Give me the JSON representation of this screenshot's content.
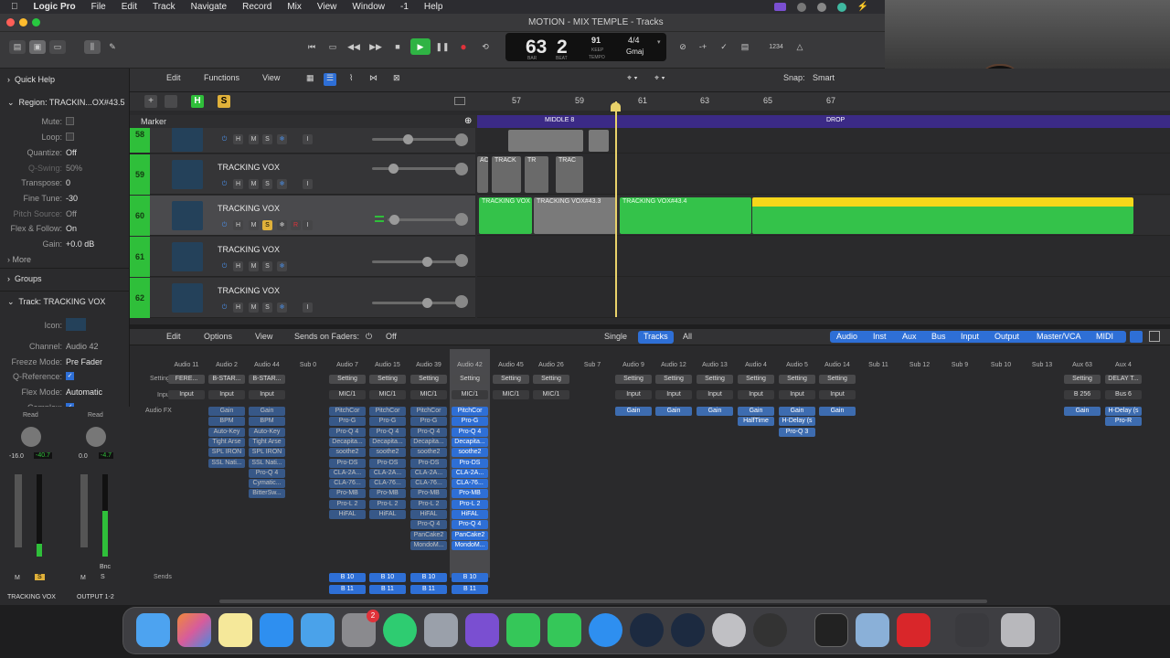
{
  "menubar": {
    "app": "Logic Pro",
    "items": [
      "File",
      "Edit",
      "Track",
      "Navigate",
      "Record",
      "Mix",
      "View",
      "Window",
      "-1",
      "Help"
    ]
  },
  "window": {
    "title": "MOTION - MIX TEMPLE - Tracks"
  },
  "transport": {
    "bar": "63",
    "beat": "2",
    "bar_label": "BAR",
    "beat_label": "BEAT",
    "tempo": "91",
    "tempo_mode": "KEEP",
    "tempo_label": "TEMPO",
    "time_sig": "4/4",
    "key": "Gmaj",
    "count_in": "1234"
  },
  "inspector": {
    "quick_help": "Quick Help",
    "region_label": "Region:",
    "region_name": "TRACKIN...OX#43.5",
    "rows": [
      {
        "label": "Mute:",
        "value": ""
      },
      {
        "label": "Loop:",
        "value": ""
      },
      {
        "label": "Quantize:",
        "value": "Off"
      },
      {
        "label": "Q-Swing:",
        "value": "50%"
      },
      {
        "label": "Transpose:",
        "value": "0"
      },
      {
        "label": "Fine Tune:",
        "value": "-30"
      },
      {
        "label": "Pitch Source:",
        "value": "Off"
      },
      {
        "label": "Flex & Follow:",
        "value": "On"
      },
      {
        "label": "Gain:",
        "value": "+0.0 dB"
      }
    ],
    "more": "More",
    "groups": "Groups",
    "track_label": "Track:",
    "track_name": "TRACKING VOX",
    "track_rows": [
      {
        "label": "Icon:",
        "value": ""
      },
      {
        "label": "Channel:",
        "value": "Audio 42"
      },
      {
        "label": "Freeze Mode:",
        "value": "Pre Fader"
      },
      {
        "label": "Q-Reference:",
        "value": ""
      },
      {
        "label": "Flex Mode:",
        "value": "Automatic"
      },
      {
        "label": "Complex:",
        "value": ""
      }
    ]
  },
  "tracks_toolbar": {
    "edit": "Edit",
    "functions": "Functions",
    "view": "View",
    "snap_label": "Snap:",
    "snap_value": "Smart"
  },
  "ruler": {
    "bars": [
      "57",
      "59",
      "61",
      "63",
      "65",
      "67"
    ]
  },
  "marker": {
    "label": "Marker",
    "markers": [
      "MIDDLE 8",
      "DROP"
    ]
  },
  "tracks": [
    {
      "num": "58",
      "name": "",
      "selected": false
    },
    {
      "num": "59",
      "name": "TRACKING VOX",
      "selected": false
    },
    {
      "num": "60",
      "name": "TRACKING VOX",
      "selected": true
    },
    {
      "num": "61",
      "name": "TRACKING VOX",
      "selected": false
    },
    {
      "num": "62",
      "name": "TRACKING VOX",
      "selected": false
    }
  ],
  "track_buttons": {
    "power": "⏻",
    "h": "H",
    "m": "M",
    "s": "S",
    "freeze": "❄",
    "i": "I",
    "r": "R"
  },
  "regions": {
    "r59": [
      "AC",
      "TRACK",
      "TR",
      "TRAC"
    ],
    "r60": [
      "TRACKING VOX",
      "TRACKING VOX#43.3",
      "TRACKING VOX#43.4",
      "TRACKING VOX#43.5"
    ]
  },
  "mixer": {
    "edit": "Edit",
    "options": "Options",
    "view": "View",
    "sends_label": "Sends on Faders:",
    "sends_value": "Off",
    "tabs": [
      "Single",
      "Tracks",
      "All"
    ],
    "filters": [
      "Audio",
      "Inst",
      "Aux",
      "Bus",
      "Input",
      "Output",
      "Master/VCA",
      "MIDI"
    ],
    "row_labels": {
      "setting": "Setting",
      "input": "Input",
      "audiofx": "Audio FX",
      "sends": "Sends"
    },
    "strips": [
      {
        "name": "Audio 11",
        "setting": "FERE...",
        "input": "Input",
        "fx": []
      },
      {
        "name": "Audio 2",
        "setting": "B-STAR...",
        "input": "Input",
        "fx": [
          "Gain",
          "BPM",
          "Auto-Key",
          "Tight Arse",
          "SPL IRON",
          "SSL Nati..."
        ]
      },
      {
        "name": "Audio 44",
        "setting": "B-STAR...",
        "input": "Input",
        "fx": [
          "Gain",
          "BPM",
          "Auto-Key",
          "Tight Arse",
          "SPL IRON",
          "SSL Nati...",
          "Pro-Q 4",
          "Cymatic...",
          "BitterSw..."
        ]
      },
      {
        "name": "Sub 0",
        "setting": "",
        "input": "",
        "fx": []
      },
      {
        "name": "Audio 7",
        "setting": "Setting",
        "input": "MIC/1",
        "fx": [
          "PitchCor",
          "Pro-G",
          "Pro-Q 4",
          "Decapita...",
          "soothe2",
          "Pro-DS",
          "CLA-2A...",
          "CLA-76...",
          "Pro-MB",
          "Pro-L 2",
          "HiFAL"
        ]
      },
      {
        "name": "Audio 15",
        "setting": "Setting",
        "input": "MIC/1",
        "fx": [
          "PitchCor",
          "Pro-G",
          "Pro-Q 4",
          "Decapita...",
          "soothe2",
          "Pro-DS",
          "CLA-2A...",
          "CLA-76...",
          "Pro-MB",
          "Pro-L 2",
          "HiFAL"
        ]
      },
      {
        "name": "Audio 39",
        "setting": "Setting",
        "input": "MIC/1",
        "fx": [
          "PitchCor",
          "Pro-G",
          "Pro-Q 4",
          "Decapita...",
          "soothe2",
          "Pro-DS",
          "CLA-2A...",
          "CLA-76...",
          "Pro-MB",
          "Pro-L 2",
          "HiFAL",
          "Pro-Q 4",
          "PanCake2",
          "MondoM..."
        ]
      },
      {
        "name": "Audio 42",
        "setting": "Setting",
        "input": "MIC/1",
        "fx": [
          "PitchCor",
          "Pro-G",
          "Pro-Q 4",
          "Decapita...",
          "soothe2",
          "Pro-DS",
          "CLA-2A...",
          "CLA-76...",
          "Pro-MB",
          "Pro-L 2",
          "HiFAL",
          "Pro-Q 4",
          "PanCake2",
          "MondoM..."
        ]
      },
      {
        "name": "Audio 45",
        "setting": "Setting",
        "input": "MIC/1",
        "fx": []
      },
      {
        "name": "Audio 26",
        "setting": "Setting",
        "input": "MIC/1",
        "fx": []
      },
      {
        "name": "Sub 7",
        "setting": "",
        "input": "",
        "fx": []
      },
      {
        "name": "Audio 9",
        "setting": "Setting",
        "input": "Input",
        "fx": [
          "Gain"
        ]
      },
      {
        "name": "Audio 12",
        "setting": "Setting",
        "input": "Input",
        "fx": [
          "Gain"
        ]
      },
      {
        "name": "Audio 13",
        "setting": "Setting",
        "input": "Input",
        "fx": [
          "Gain"
        ]
      },
      {
        "name": "Audio 4",
        "setting": "Setting",
        "input": "Input",
        "fx": [
          "Gain",
          "HalfTime"
        ]
      },
      {
        "name": "Audio 5",
        "setting": "Setting",
        "input": "Input",
        "fx": [
          "Gain",
          "H-Delay (s",
          "Pro-Q 3"
        ]
      },
      {
        "name": "Audio 14",
        "setting": "Setting",
        "input": "Input",
        "fx": [
          "Gain"
        ]
      },
      {
        "name": "Sub 11",
        "setting": "",
        "input": "",
        "fx": []
      },
      {
        "name": "Sub 12",
        "setting": "",
        "input": "",
        "fx": []
      },
      {
        "name": "Sub 9",
        "setting": "",
        "input": "",
        "fx": []
      },
      {
        "name": "Sub 10",
        "setting": "",
        "input": "",
        "fx": []
      },
      {
        "name": "Sub 13",
        "setting": "",
        "input": "",
        "fx": []
      },
      {
        "name": "Aux 63",
        "setting": "Setting",
        "input": "B 256",
        "fx": [
          "Gain"
        ]
      },
      {
        "name": "Aux 4",
        "setting": "DELAY T...",
        "input": "Bus 6",
        "fx": [
          "H-Delay (s",
          "Pro-R"
        ]
      }
    ],
    "sends": [
      "B 10",
      "B 11"
    ]
  },
  "left_strips": [
    {
      "name": "TRACKING VOX",
      "read": "Read",
      "vals": [
        "-16.0",
        "-40.7"
      ],
      "mute": "M",
      "solo": "S"
    },
    {
      "name": "OUTPUT 1-2",
      "read": "Read",
      "vals": [
        "0.0",
        "-4.7"
      ],
      "mute": "M",
      "solo": "S",
      "bnc": "Bnc"
    }
  ],
  "dock": {
    "badge": "2",
    "apps": [
      "finder",
      "launchpad",
      "notes",
      "app-store",
      "mail",
      "settings",
      "whatsapp",
      "phone",
      "elements",
      "messages",
      "facetime",
      "safari",
      "waves",
      "waves-central",
      "logic",
      "obs",
      "terminal",
      "preview",
      "acrobat",
      "trash"
    ]
  },
  "colors": {
    "green": "#34c24a",
    "yellow": "#f5d71a",
    "blue": "#2e6fd6",
    "purple": "#3b2a86",
    "track_num": "#2fbf3a"
  }
}
